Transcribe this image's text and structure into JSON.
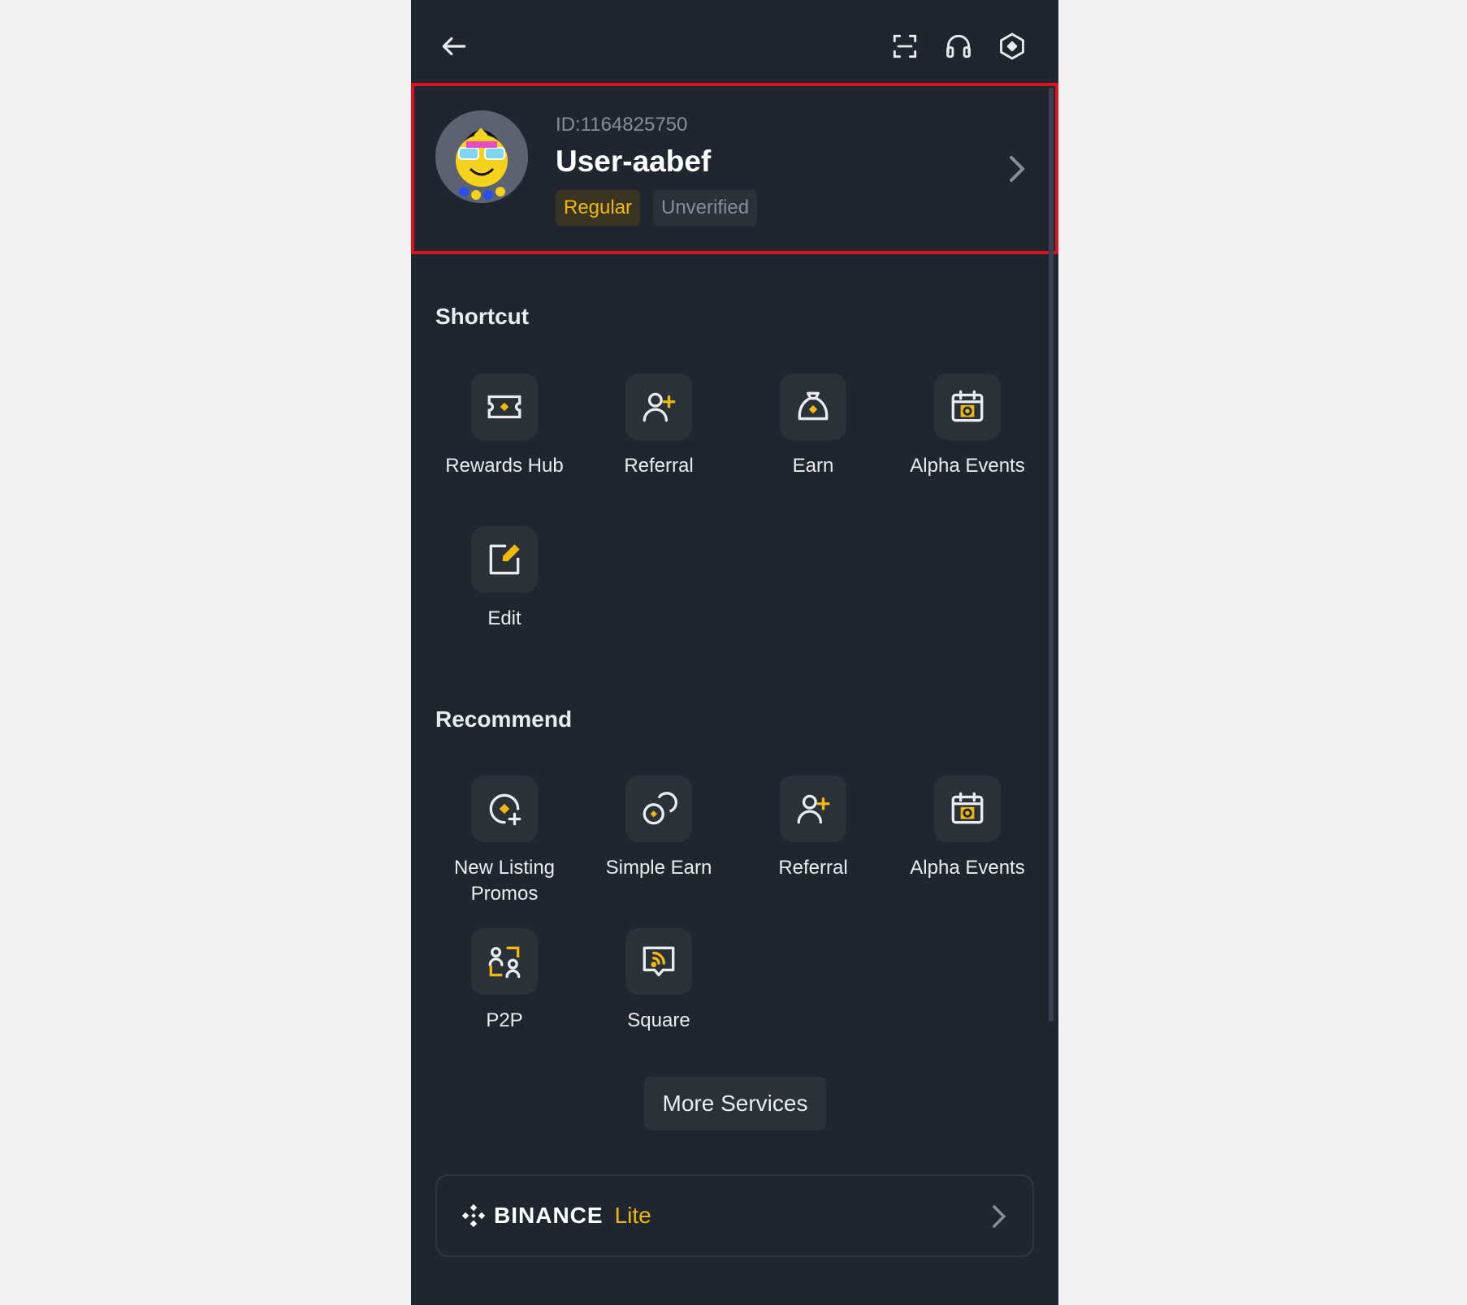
{
  "profile": {
    "id_text": "ID:1164825750",
    "username": "User-aabef",
    "badges": {
      "regular": "Regular",
      "unverified": "Unverified"
    }
  },
  "shortcut": {
    "title": "Shortcut",
    "items": [
      {
        "label": "Rewards Hub",
        "icon": "ticket-icon"
      },
      {
        "label": "Referral",
        "icon": "add-user-icon"
      },
      {
        "label": "Earn",
        "icon": "money-bag-icon"
      },
      {
        "label": "Alpha Events",
        "icon": "calendar-alpha-icon"
      },
      {
        "label": "Edit",
        "icon": "edit-icon"
      }
    ]
  },
  "recommend": {
    "title": "Recommend",
    "items": [
      {
        "label": "New Listing Promos",
        "icon": "new-listing-icon"
      },
      {
        "label": "Simple Earn",
        "icon": "simple-earn-icon"
      },
      {
        "label": "Referral",
        "icon": "add-user-icon"
      },
      {
        "label": "Alpha Events",
        "icon": "calendar-alpha-icon"
      },
      {
        "label": "P2P",
        "icon": "p2p-icon"
      },
      {
        "label": "Square",
        "icon": "square-feed-icon"
      }
    ]
  },
  "more_services": "More Services",
  "lite": {
    "brand": "BINANCE",
    "suffix": "Lite"
  },
  "colors": {
    "background": "#202630",
    "accent": "#f0b90b",
    "tile": "#2b3139",
    "highlight_border": "#e0101e"
  }
}
